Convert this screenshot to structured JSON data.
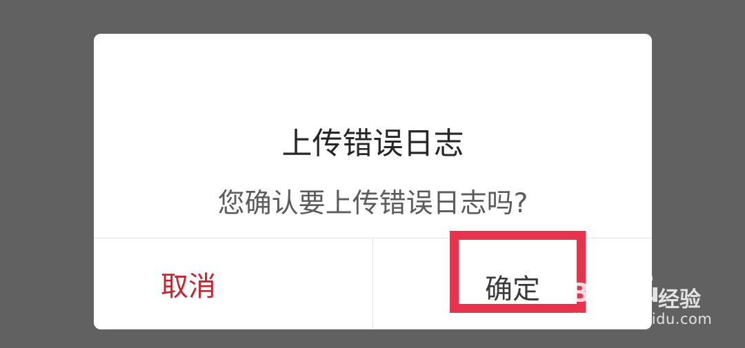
{
  "dialog": {
    "title": "上传错误日志",
    "message": "您确认要上传错误日志吗?",
    "cancel_label": "取消",
    "confirm_label": "确定"
  },
  "watermark": {
    "logo_text": "Bai du",
    "brand_text": "经验",
    "url": "jingyan.baidu.com"
  },
  "colors": {
    "overlay": "#616161",
    "dialog_bg": "#ffffff",
    "cancel_text": "#c8232c",
    "highlight_border": "#e6344f"
  }
}
